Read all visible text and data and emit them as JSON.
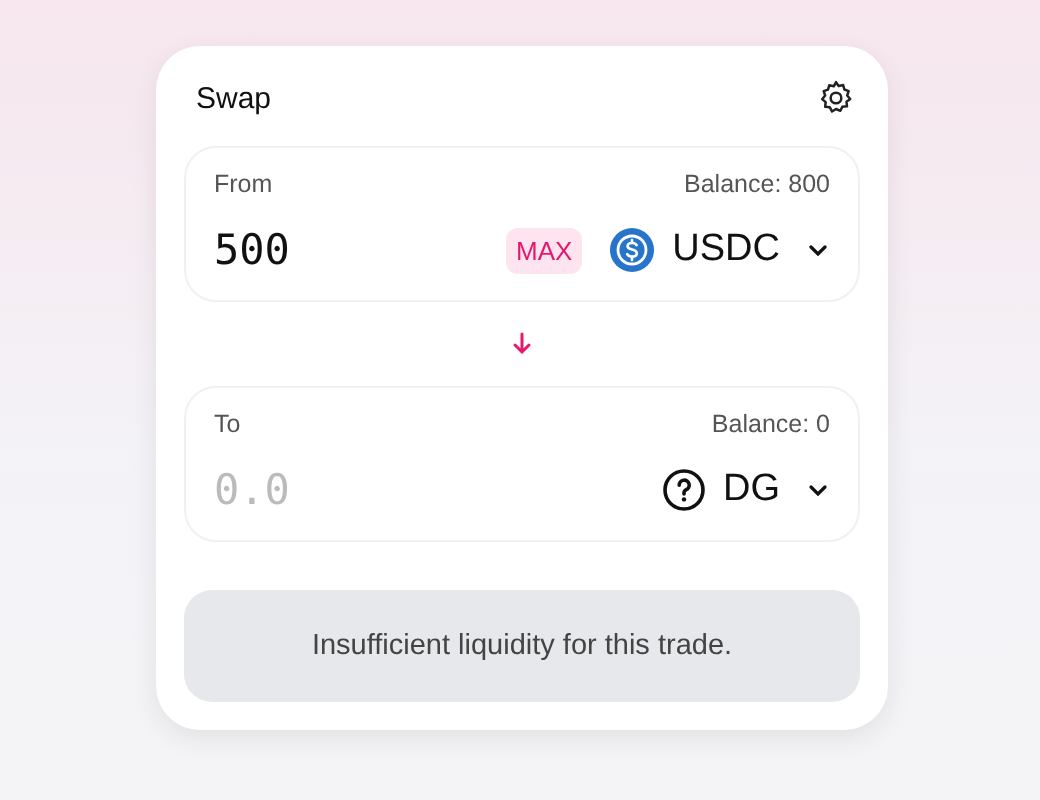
{
  "title": "Swap",
  "panels": [
    {
      "label": "From",
      "balance": "Balance: 800",
      "value": "500",
      "max": "MAX",
      "token": {
        "symbol": "USDC",
        "kind": "usdc"
      }
    },
    {
      "label": "To",
      "balance": "Balance: 0",
      "placeholder": "0.0",
      "token": {
        "symbol": "DG",
        "kind": "unknown"
      }
    }
  ],
  "submit": {
    "label": "Insufficient liquidity for this trade.",
    "disabled": true
  }
}
